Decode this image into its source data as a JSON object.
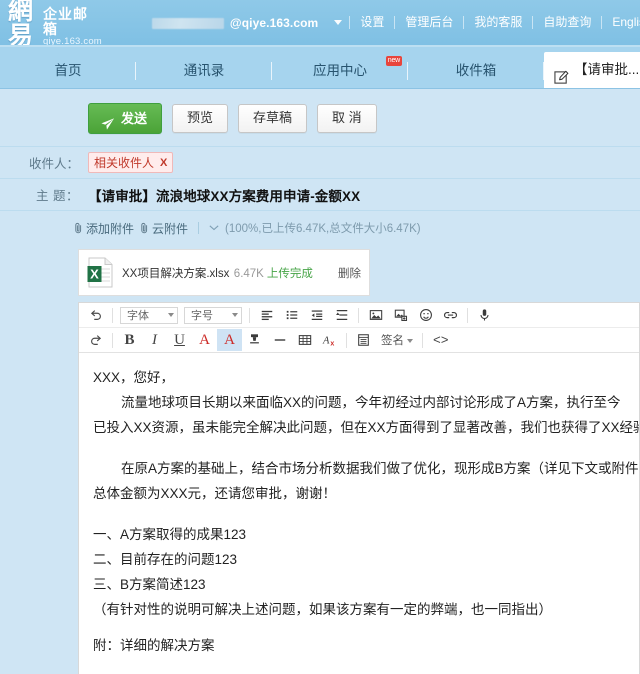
{
  "header": {
    "logo": "網易",
    "product_name": "企业邮箱",
    "product_domain": "qiye.163.com",
    "account_domain": "@qiye.163.com",
    "account_caret_icon": "chevron-down-icon",
    "links": [
      "设置",
      "管理后台",
      "我的客服",
      "自助查询",
      "English"
    ]
  },
  "tabs": {
    "items": [
      {
        "label": "首页",
        "active": false,
        "badge": ""
      },
      {
        "label": "通讯录",
        "active": false,
        "badge": ""
      },
      {
        "label": "应用中心",
        "active": false,
        "badge": "new"
      },
      {
        "label": "收件箱",
        "active": false,
        "badge": ""
      }
    ],
    "active_tab": {
      "label": "【请审批...",
      "icon": "compose-pen-icon",
      "close_icon": "close-icon"
    },
    "more_icon": "chevron-down-icon"
  },
  "compose": {
    "actions": {
      "send": "发送",
      "send_icon": "paper-plane-icon",
      "preview": "预览",
      "save_draft": "存草稿",
      "cancel": "取 消"
    },
    "to": {
      "label": "收件人：",
      "chip": "相关收件人",
      "chip_remove": "X"
    },
    "subject": {
      "label": "主  题：",
      "value": "【请审批】流浪地球XX方案费用申请-金额XX"
    },
    "attachment_bar": {
      "add_attachment": "添加附件",
      "cloud_attachment": "云附件",
      "attach_icon": "paperclip-icon",
      "more_icon": "chevron-down-icon",
      "progress_text": "(100%,已上传6.47K,总文件大小6.47K)"
    },
    "attachment": {
      "icon": "excel-file-icon",
      "filename": "XX项目解决方案.xlsx",
      "size": "6.47K",
      "status": "上传完成",
      "delete": "删除"
    }
  },
  "editor": {
    "toolbar_row1": {
      "undo_icon": "undo-icon",
      "font_family": "字体",
      "font_size": "字号",
      "align_icon": "align-left-icon",
      "list_icon": "bullet-list-icon",
      "indent_icon": "outdent-icon",
      "line_height_icon": "line-height-icon",
      "image_icon": "insert-image-icon",
      "screenshot_icon": "screenshot-icon",
      "emoji_icon": "emoji-icon",
      "link_icon": "link-icon",
      "voice_icon": "microphone-icon"
    },
    "toolbar_row2": {
      "redo_icon": "redo-icon",
      "bold": "B",
      "italic": "I",
      "underline": "U",
      "font_color": "A",
      "highlight": "A",
      "format_brush_icon": "format-painter-icon",
      "hr_icon": "horizontal-rule-icon",
      "table_icon": "insert-table-icon",
      "clear_format_icon": "clear-format-icon",
      "card_icon": "card-icon",
      "signature": "签名",
      "signature_caret_icon": "chevron-down-icon",
      "source_code": "<>"
    },
    "body": {
      "greeting": "XXX，您好，",
      "para1_line1": "流量地球项目长期以来面临XX的问题，今年初经过内部讨论形成了A方案，执行至今",
      "para1_line2": "已投入XX资源，虽未能完全解决此问题，但在XX方面得到了显著改善，我们也获得了XX经验。",
      "para2_line1": "在原A方案的基础上，结合市场分析数据我们做了优化，现形成B方案（详见下文或附件），",
      "para2_line2": "总体金额为XXX元，还请您审批，谢谢！",
      "item1": "一、A方案取得的成果123",
      "item2": "二、目前存在的问题123",
      "item3": "三、B方案简述123",
      "note": "（有针对性的说明可解决上述问题，如果该方案有一定的弊端，也一同指出）",
      "appendix": "附：详细的解决方案"
    }
  },
  "colors": {
    "header_blue": "#8fc9e8",
    "tabbar_blue": "#a6d4ee",
    "page_blue": "#cfe5f4",
    "send_green": "#4ba337",
    "chip_red": "#c0392b",
    "badge_red": "#e8453c",
    "excel_green": "#217346"
  }
}
